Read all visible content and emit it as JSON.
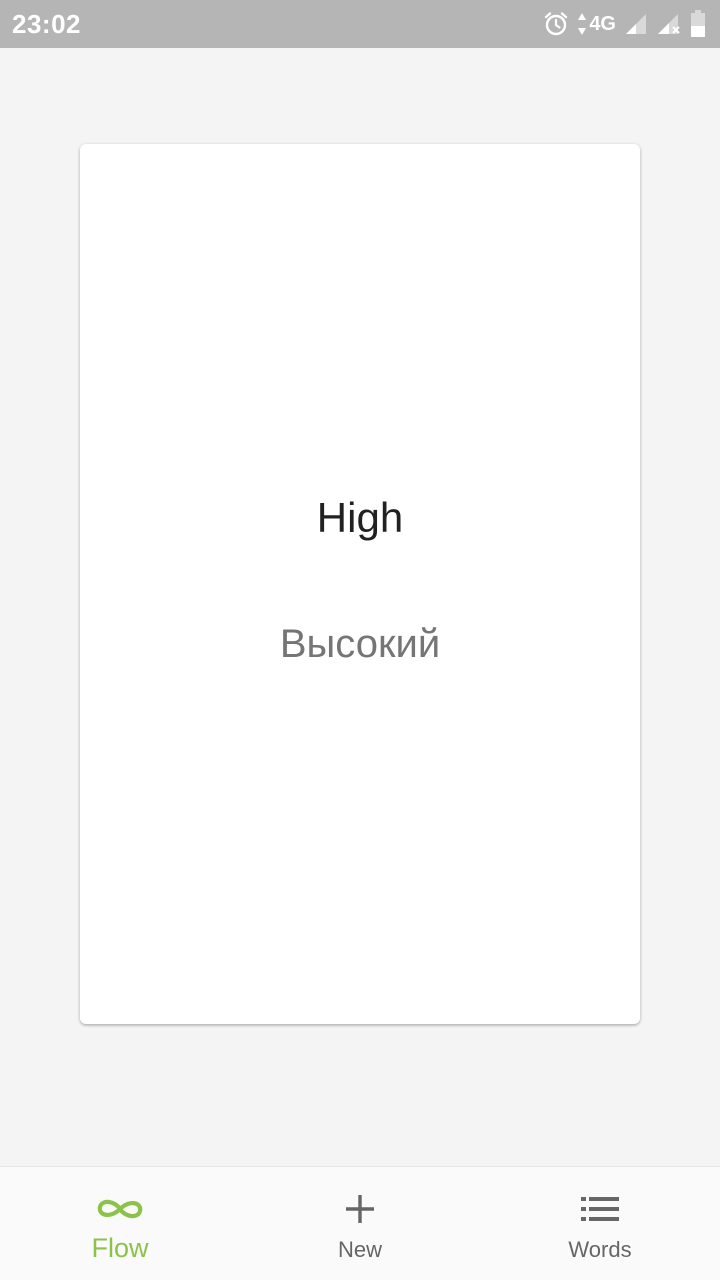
{
  "status_bar": {
    "time": "23:02",
    "network": "4G",
    "icons": [
      "alarm-icon",
      "data-arrows-icon",
      "signal-icon",
      "signal-no-sim-icon",
      "battery-icon"
    ]
  },
  "card": {
    "word": "High",
    "translation": "Высокий"
  },
  "bottom_nav": {
    "items": [
      {
        "label": "Flow",
        "icon": "infinity-icon",
        "active": true
      },
      {
        "label": "New",
        "icon": "plus-icon",
        "active": false
      },
      {
        "label": "Words",
        "icon": "list-icon",
        "active": false
      }
    ]
  },
  "colors": {
    "accent": "#8bc34a",
    "status_bar": "#b5b5b5",
    "background": "#f4f4f4",
    "inactive": "#666666"
  }
}
